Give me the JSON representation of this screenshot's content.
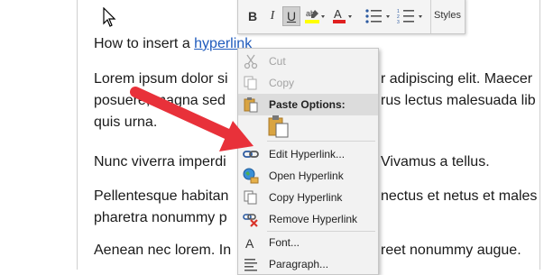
{
  "document": {
    "p1_prefix": "How to insert a ",
    "p1_link": "hyperlink",
    "p2_line1_a": "Lorem ipsum dolor si",
    "p2_line1_b": "r adipiscing elit. Maecer",
    "p2_line2_a": "posuere, magna sed",
    "p2_line2_b": "rus lectus malesuada lib",
    "p2_line3": "quis urna.",
    "p3_a": "Nunc viverra imperdi",
    "p3_b": "Vivamus a tellus.",
    "p4_line1_a": "Pellentesque habitan",
    "p4_line1_b": "nectus et netus et males",
    "p4_line2": "pharetra nonummy p",
    "p5_a": "Aenean nec lorem. In",
    "p5_b": "reet nonummy augue."
  },
  "mini_toolbar": {
    "bold": "B",
    "italic": "I",
    "underline": "U",
    "styles_label": "Styles",
    "highlight_color": "#ffff00",
    "font_color": "#e02020"
  },
  "context_menu": {
    "items": [
      {
        "label": "Cut",
        "icon": "scissors-icon",
        "disabled": true
      },
      {
        "label": "Copy",
        "icon": "copy-icon",
        "disabled": true
      },
      {
        "label": "Paste Options:",
        "icon": "paste-icon",
        "header": true
      },
      {
        "label": "Edit Hyperlink...",
        "icon": "link-icon"
      },
      {
        "label": "Open Hyperlink",
        "icon": "globe-icon"
      },
      {
        "label": "Copy Hyperlink",
        "icon": "copy-link-icon"
      },
      {
        "label": "Remove Hyperlink",
        "icon": "remove-link-icon"
      },
      {
        "label": "Font...",
        "icon": "font-icon"
      },
      {
        "label": "Paragraph...",
        "icon": "paragraph-icon"
      }
    ]
  },
  "annotation": {
    "arrow_color": "#e8313a"
  }
}
